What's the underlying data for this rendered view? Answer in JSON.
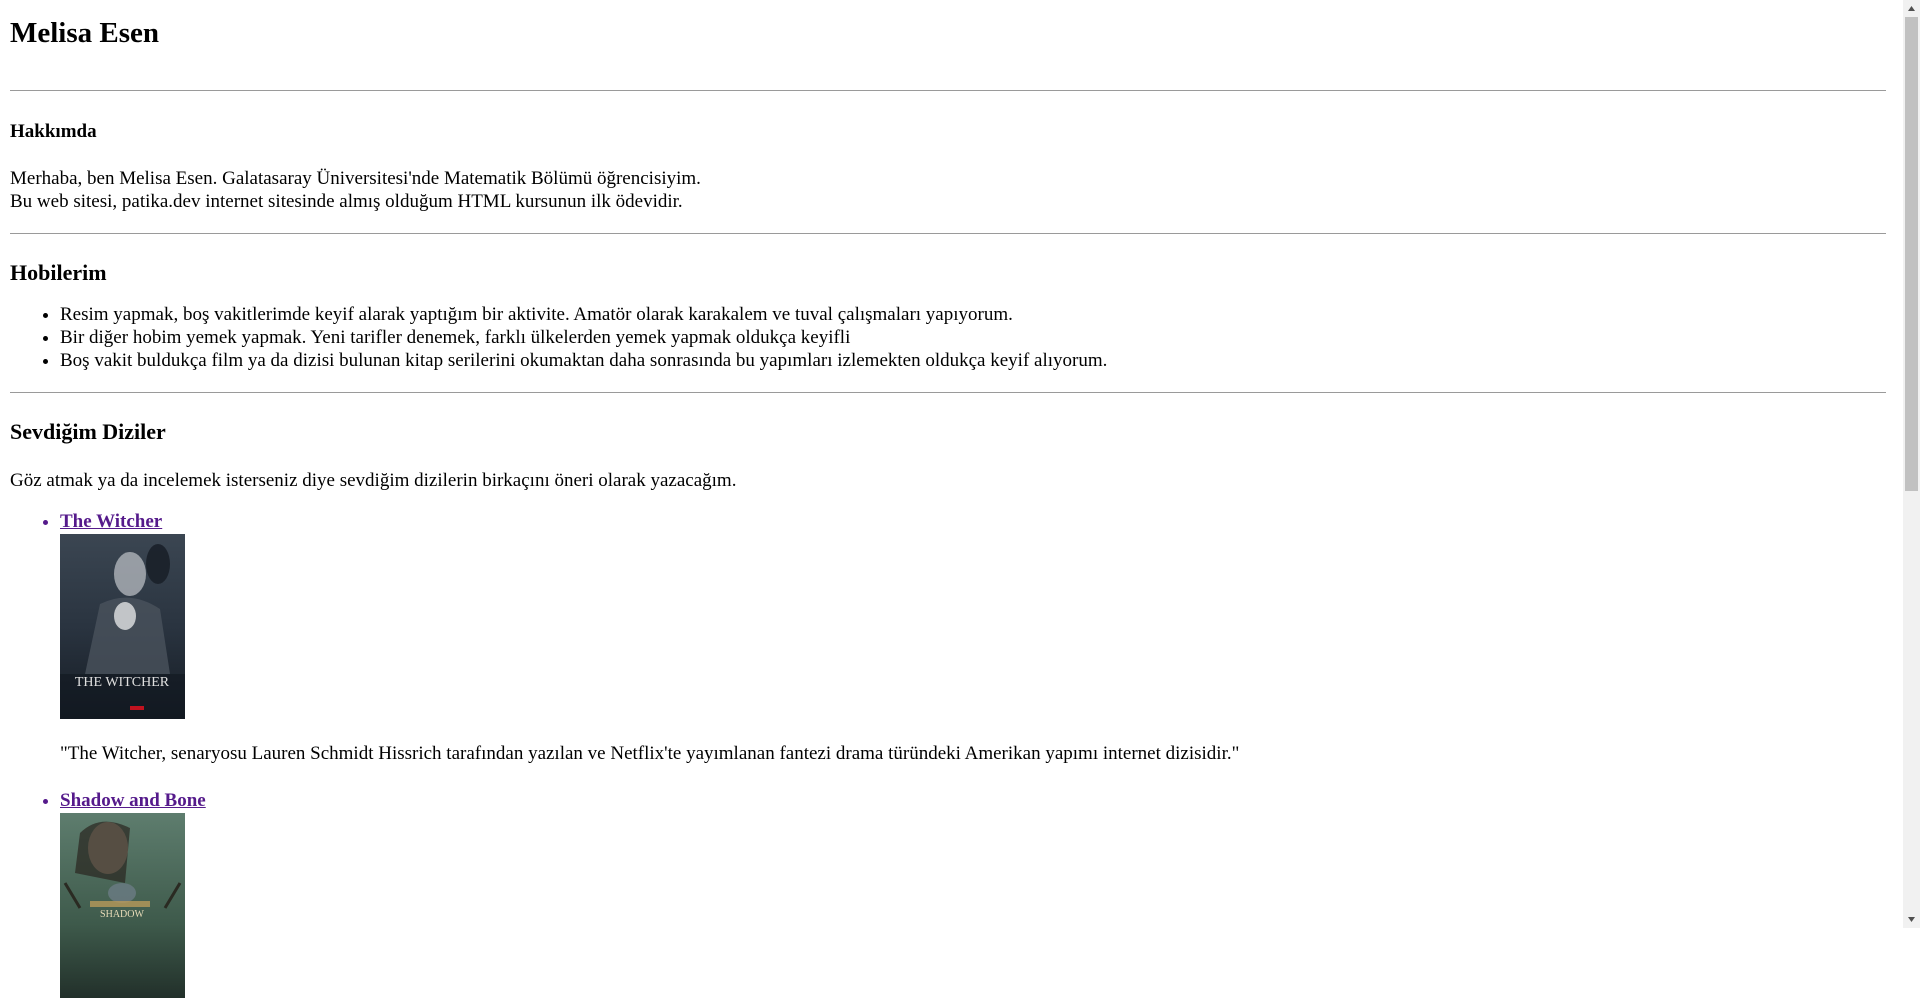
{
  "title": "Melisa Esen",
  "about": {
    "heading": "Hakkımda",
    "line1": "Merhaba, ben Melisa Esen. Galatasaray Üniversitesi'nde Matematik Bölümü öğrencisiyim.",
    "line2": "Bu web sitesi, patika.dev internet sitesinde almış olduğum HTML kursunun ilk ödevidir."
  },
  "hobbies": {
    "heading": "Hobilerim",
    "items": [
      "Resim yapmak, boş vakitlerimde keyif alarak yaptığım bir aktivite. Amatör olarak karakalem ve tuval çalışmaları yapıyorum.",
      "Bir diğer hobim yemek yapmak. Yeni tarifler denemek, farklı ülkelerden yemek yapmak oldukça keyifli",
      "Boş vakit buldukça film ya da dizisi bulunan kitap serilerini okumaktan daha sonrasında bu yapımları izlemekten oldukça keyif alıyorum."
    ]
  },
  "series": {
    "heading": "Sevdiğim Diziler",
    "intro": "Göz atmak ya da incelemek isterseniz diye sevdiğim dizilerin birkaçını öneri olarak yazacağım.",
    "items": [
      {
        "title": "The Witcher",
        "poster_text": "THE WITCHER",
        "description": "\"The Witcher, senaryosu Lauren Schmidt Hissrich tarafından yazılan ve Netflix'te yayımlanan fantezi drama türündeki Amerikan yapımı internet dizisidir.\""
      },
      {
        "title": "Shadow and Bone",
        "poster_text": "SHADOW"
      }
    ]
  },
  "colors": {
    "link_visited": "#551a8b",
    "divider": "#9a9a9a",
    "scrollbar_track": "#f1f1f1",
    "scrollbar_thumb": "#c1c1c1"
  }
}
